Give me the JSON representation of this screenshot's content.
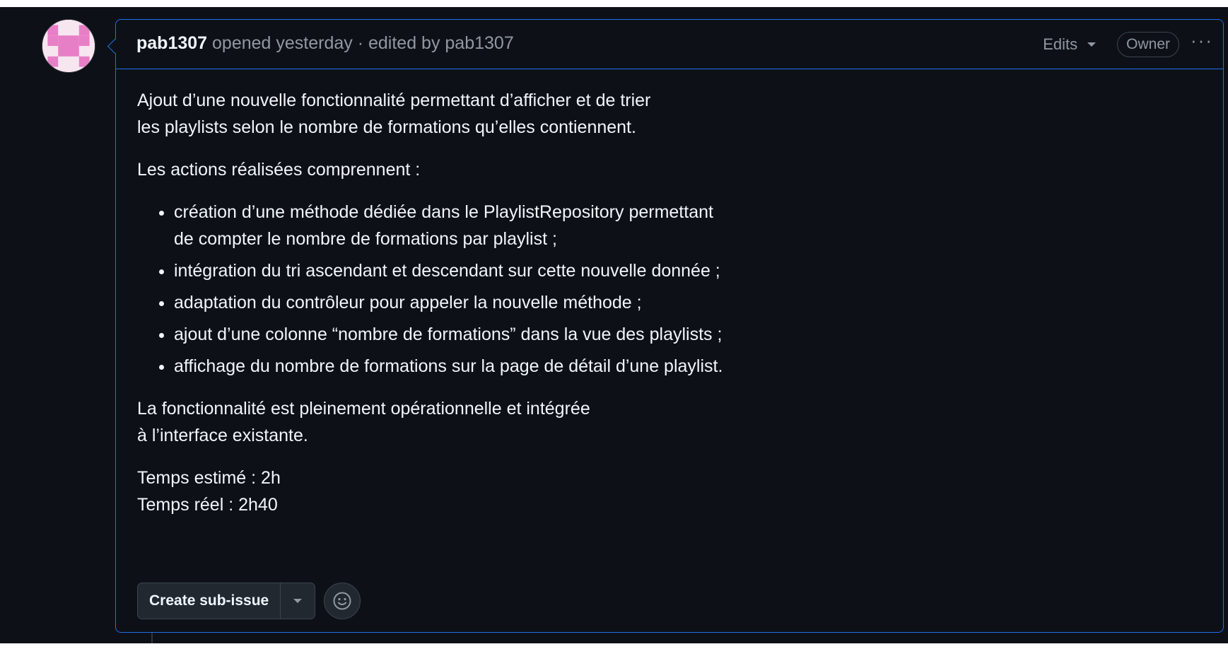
{
  "header": {
    "author": "pab1307",
    "meta_text": " opened yesterday · edited by pab1307",
    "edits_label": "Edits",
    "owner_badge": "Owner",
    "more_label": "···"
  },
  "body": {
    "intro_line1": "Ajout d’une nouvelle fonctionnalité permettant d’afficher et de trier",
    "intro_line2": "les playlists selon le nombre de formations qu’elles contiennent.",
    "actions_heading": "Les actions réalisées comprennent :",
    "list": [
      {
        "line1": "création d’une méthode dédiée dans le PlaylistRepository permettant",
        "line2": "de compter le nombre de formations par playlist ;"
      },
      {
        "line1": "intégration du tri ascendant et descendant sur cette nouvelle donnée ;"
      },
      {
        "line1": "adaptation du contrôleur pour appeler la nouvelle méthode ;"
      },
      {
        "line1": "ajout d’une colonne “nombre de formations” dans la vue des playlists ;"
      },
      {
        "line1": "affichage du nombre de formations sur la page de détail d’une playlist."
      }
    ],
    "conclusion_line1": "La fonctionnalité est pleinement opérationnelle et intégrée",
    "conclusion_line2": "à l’interface existante.",
    "time_estimated": "Temps estimé : 2h",
    "time_real": "Temps réel : 2h40"
  },
  "actions": {
    "create_sub_issue_label": "Create sub-issue"
  },
  "icons": {
    "avatar": "identicon-avatar",
    "edits_caret": "chevron-down-icon",
    "more": "kebab-horizontal-icon",
    "split_caret": "triangle-down-icon",
    "reaction": "smiley-icon"
  },
  "colors": {
    "background": "#0d1117",
    "border_accent": "#1f6feb",
    "text_primary": "#f0f6fc",
    "text_muted": "#9198a1",
    "avatar_pink": "#e77fc6"
  }
}
